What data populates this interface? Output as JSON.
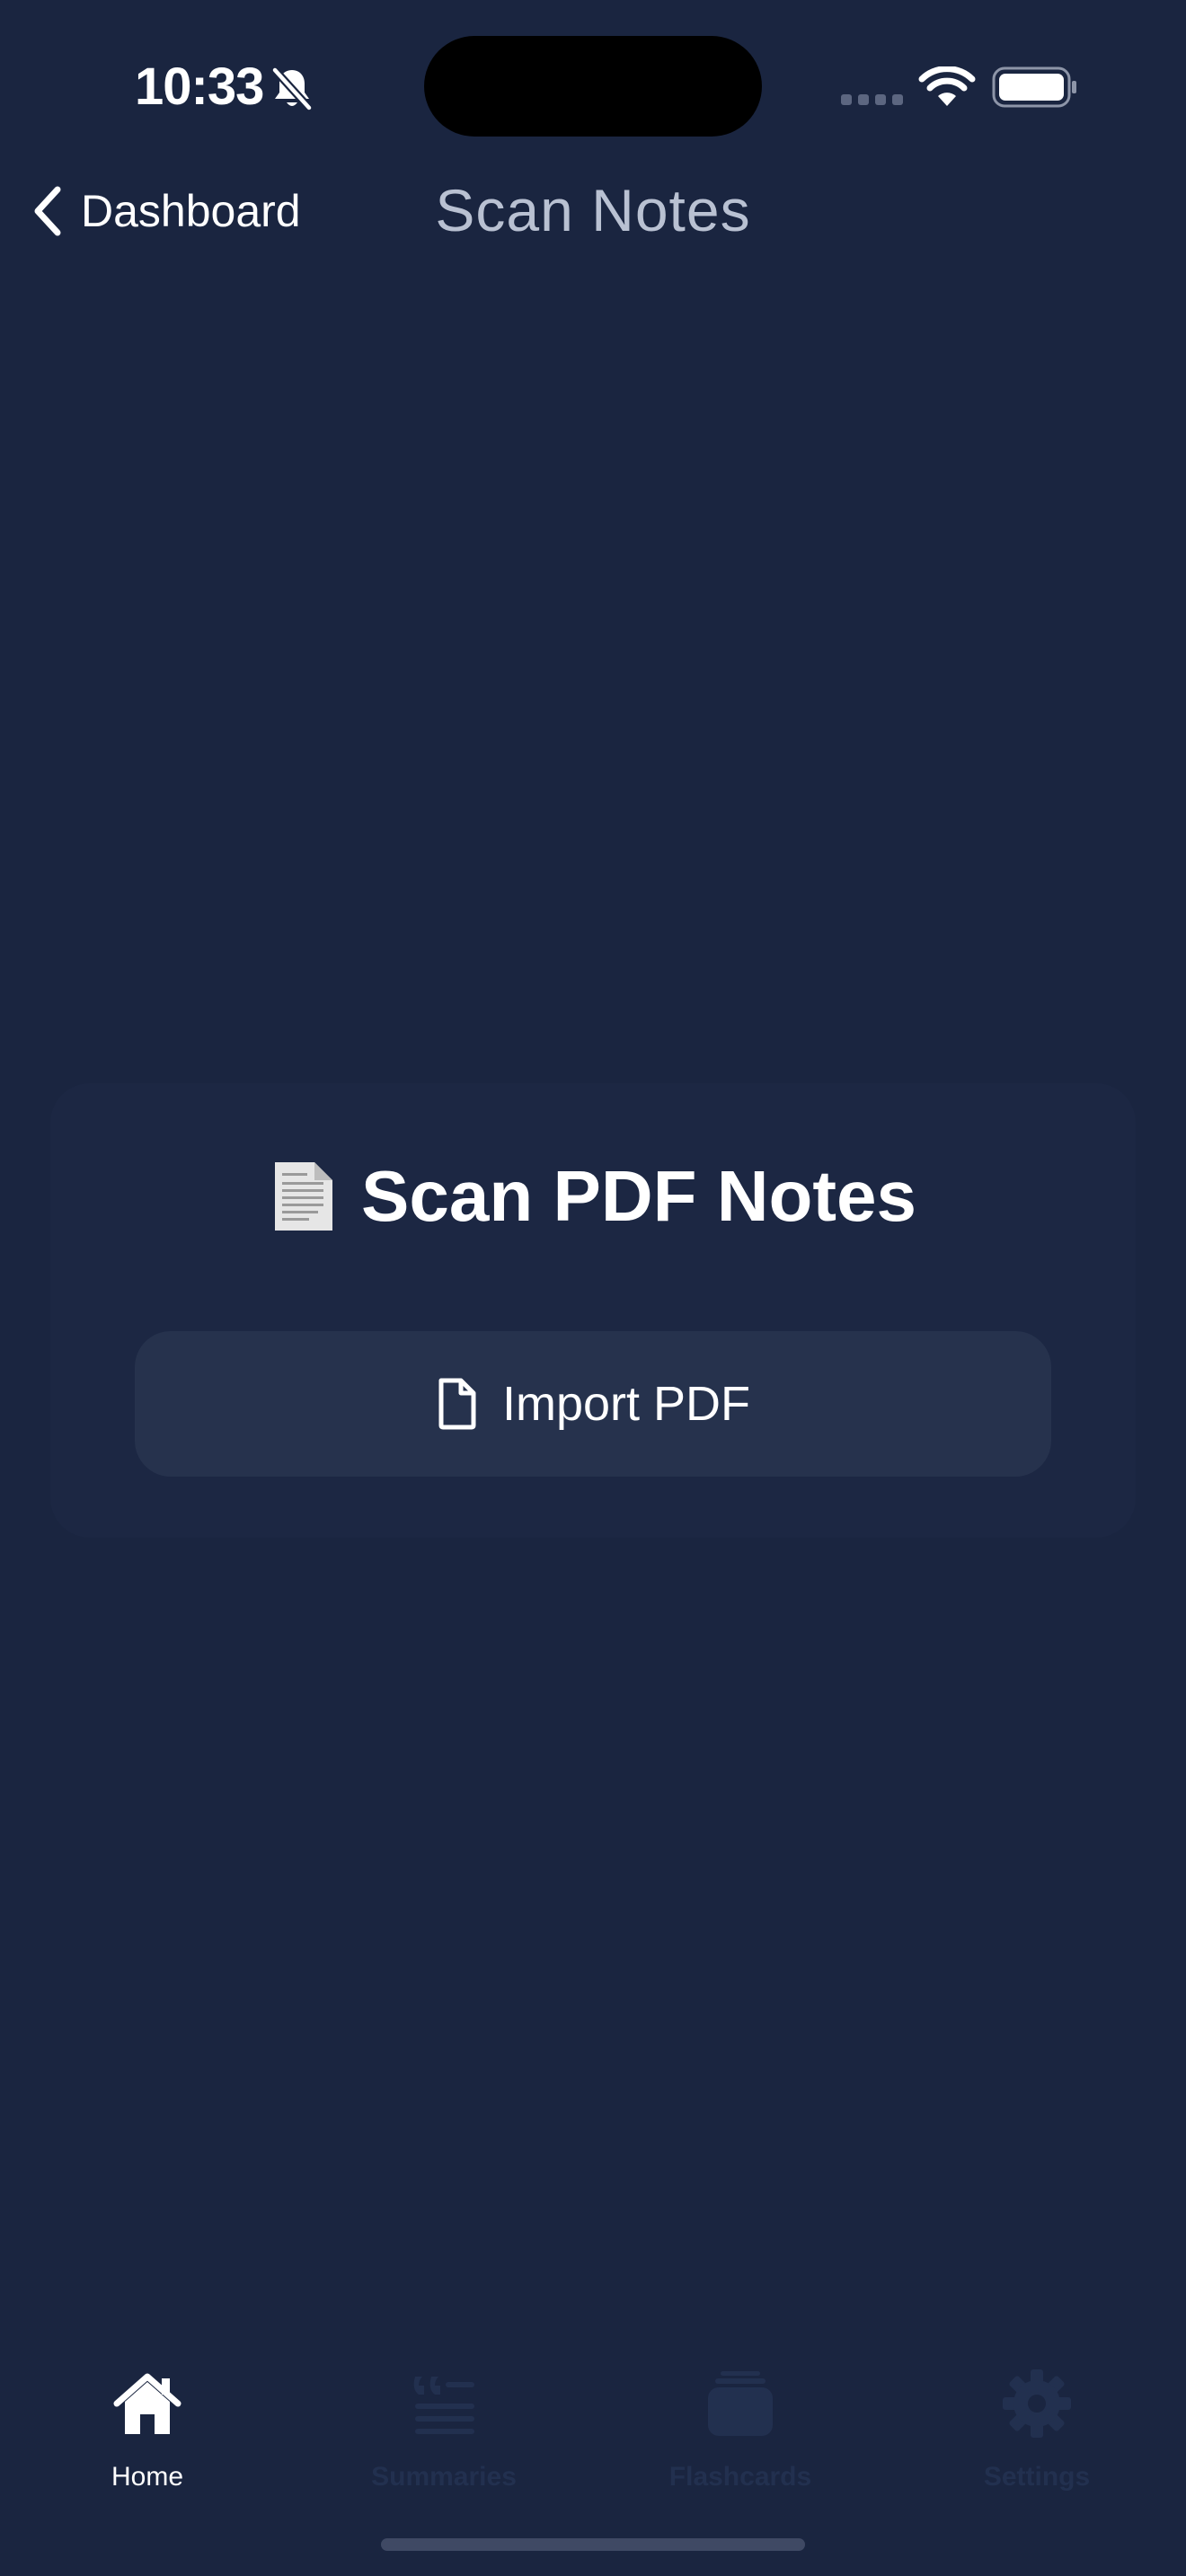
{
  "status_bar": {
    "time": "10:33",
    "icons": [
      "bell-slash-icon",
      "cellular-signal-icon",
      "wifi-icon",
      "battery-icon"
    ]
  },
  "nav": {
    "back_label": "Dashboard",
    "back_icon": "chevron-left-icon",
    "title": "Scan Notes"
  },
  "card": {
    "title": "Scan PDF Notes",
    "title_icon": "page-facing-up-icon",
    "import_button": {
      "label": "Import PDF",
      "icon": "document-icon"
    }
  },
  "tabs": [
    {
      "label": "Home",
      "icon": "house-icon",
      "active": true
    },
    {
      "label": "Summaries",
      "icon": "quote-text-icon",
      "active": false
    },
    {
      "label": "Flashcards",
      "icon": "cards-stack-icon",
      "active": false
    },
    {
      "label": "Settings",
      "icon": "gear-icon",
      "active": false
    }
  ],
  "colors": {
    "background": "#1a2540",
    "card": "#1c2743",
    "button": "#26324d",
    "nav_title": "#b9c1d2",
    "inactive_tab": "#22304f",
    "active_tab": "#ffffff"
  }
}
